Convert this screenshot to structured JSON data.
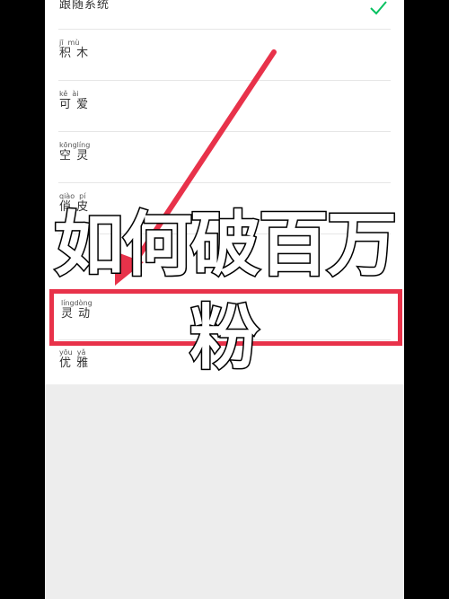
{
  "settings_list": {
    "items": [
      {
        "pinyin": "",
        "label": "跟随系统",
        "selected": true
      },
      {
        "pinyin": "jī  mù",
        "label": "积 木",
        "selected": false
      },
      {
        "pinyin": "kě  ài",
        "label": "可 爱",
        "selected": false
      },
      {
        "pinyin": "kōnglíng",
        "label": "空 灵",
        "selected": false
      },
      {
        "pinyin": "qiào  pí",
        "label": "俏 皮",
        "selected": false
      },
      {
        "pinyin": "língdòng",
        "label": "灵 动",
        "selected": false
      },
      {
        "pinyin": "yōu  yǎ",
        "label": "优 雅",
        "selected": false
      }
    ]
  },
  "overlay": {
    "caption_line_1": "如何破百万",
    "caption_line_2": "粉",
    "highlight_target": "灵 动"
  },
  "colors": {
    "accent_red": "#e8324a",
    "check_green": "#07c160",
    "background": "#000000"
  },
  "icons": {
    "selected_indicator": "check-icon"
  }
}
